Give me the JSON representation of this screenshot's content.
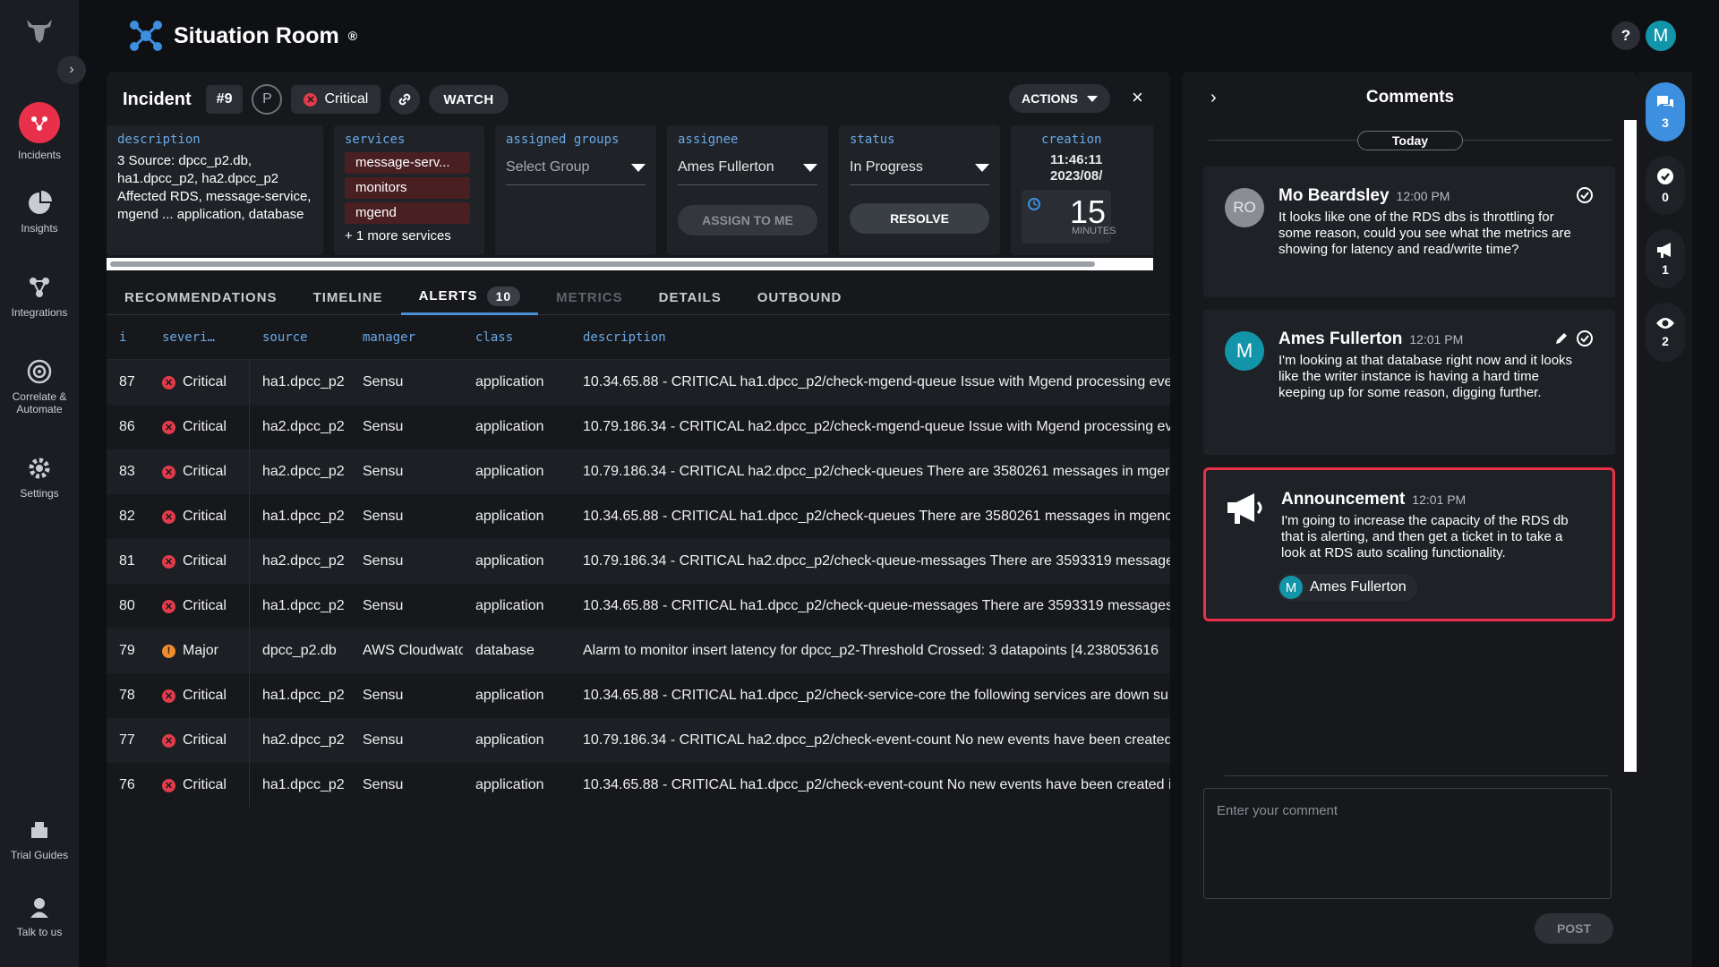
{
  "app": {
    "title": "Situation Room",
    "trademark": "®",
    "help": "?",
    "user_initial": "M"
  },
  "nav": {
    "items": [
      {
        "label": "Incidents",
        "icon": "incidents-icon"
      },
      {
        "label": "Insights",
        "icon": "pie-chart-icon"
      },
      {
        "label": "Integrations",
        "icon": "integrations-icon"
      },
      {
        "label": "Correlate & Automate",
        "icon": "target-icon"
      },
      {
        "label": "Settings",
        "icon": "gear-icon"
      },
      {
        "label": "Trial Guides",
        "icon": "book-icon"
      },
      {
        "label": "Talk to us",
        "icon": "support-icon"
      }
    ]
  },
  "incident": {
    "label": "Incident",
    "number": "#9",
    "priority": "P",
    "severity": "Critical",
    "watch": "WATCH",
    "actions": "ACTIONS",
    "close": "×",
    "description": {
      "label": "description",
      "text": "3 Source: dpcc_p2.db, ha1.dpcc_p2, ha2.dpcc_p2 Affected RDS, message-service, mgend ... application, database"
    },
    "services": {
      "label": "services",
      "items": [
        "message-serv...",
        "monitors",
        "mgend"
      ],
      "more": "+ 1 more services"
    },
    "groups": {
      "label": "assigned groups",
      "placeholder": "Select Group"
    },
    "assignee": {
      "label": "assignee",
      "value": "Ames Fullerton",
      "assign_me": "ASSIGN TO ME"
    },
    "status": {
      "label": "status",
      "value": "In Progress",
      "resolve": "RESOLVE"
    },
    "creation": {
      "label": "creation",
      "time": "11:46:11",
      "date": "2023/08/",
      "timer_value": "15",
      "timer_unit": "MINUTES"
    }
  },
  "tabs": [
    {
      "label": "RECOMMENDATIONS"
    },
    {
      "label": "TIMELINE"
    },
    {
      "label": "ALERTS",
      "badge": "10"
    },
    {
      "label": "METRICS"
    },
    {
      "label": "DETAILS"
    },
    {
      "label": "OUTBOUND"
    }
  ],
  "alerts": {
    "columns": [
      "i",
      "severi…",
      "source",
      "manager",
      "class",
      "description"
    ],
    "rows": [
      {
        "id": "87",
        "severity": "Critical",
        "source": "ha1.dpcc_p2",
        "manager": "Sensu",
        "class": "application",
        "description": "10.34.65.88 - CRITICAL ha1.dpcc_p2/check-mgend-queue Issue with Mgend processing eve"
      },
      {
        "id": "86",
        "severity": "Critical",
        "source": "ha2.dpcc_p2",
        "manager": "Sensu",
        "class": "application",
        "description": "10.79.186.34 - CRITICAL ha2.dpcc_p2/check-mgend-queue Issue with Mgend processing ev"
      },
      {
        "id": "83",
        "severity": "Critical",
        "source": "ha2.dpcc_p2",
        "manager": "Sensu",
        "class": "application",
        "description": "10.79.186.34 - CRITICAL ha2.dpcc_p2/check-queues There are 3580261 messages in mger"
      },
      {
        "id": "82",
        "severity": "Critical",
        "source": "ha1.dpcc_p2",
        "manager": "Sensu",
        "class": "application",
        "description": "10.34.65.88 - CRITICAL ha1.dpcc_p2/check-queues There are 3580261 messages in mgenc"
      },
      {
        "id": "81",
        "severity": "Critical",
        "source": "ha2.dpcc_p2",
        "manager": "Sensu",
        "class": "application",
        "description": "10.79.186.34 - CRITICAL ha2.dpcc_p2/check-queue-messages There are 3593319 message"
      },
      {
        "id": "80",
        "severity": "Critical",
        "source": "ha1.dpcc_p2",
        "manager": "Sensu",
        "class": "application",
        "description": "10.34.65.88 - CRITICAL ha1.dpcc_p2/check-queue-messages There are 3593319 messages"
      },
      {
        "id": "79",
        "severity": "Major",
        "source": "dpcc_p2.db",
        "manager": "AWS Cloudwatc",
        "class": "database",
        "description": "Alarm to monitor insert latency for dpcc_p2-Threshold Crossed: 3 datapoints [4.238053616"
      },
      {
        "id": "78",
        "severity": "Critical",
        "source": "ha1.dpcc_p2",
        "manager": "Sensu",
        "class": "application",
        "description": "10.34.65.88 - CRITICAL ha1.dpcc_p2/check-service-core the following services are down su"
      },
      {
        "id": "77",
        "severity": "Critical",
        "source": "ha2.dpcc_p2",
        "manager": "Sensu",
        "class": "application",
        "description": "10.79.186.34 - CRITICAL ha2.dpcc_p2/check-event-count No new events have been created"
      },
      {
        "id": "76",
        "severity": "Critical",
        "source": "ha1.dpcc_p2",
        "manager": "Sensu",
        "class": "application",
        "description": "10.34.65.88 - CRITICAL ha1.dpcc_p2/check-event-count No new events have been created i"
      }
    ]
  },
  "comments": {
    "title": "Comments",
    "day": "Today",
    "items": [
      {
        "initials": "RO",
        "author": "Mo Beardsley",
        "time": "12:00 PM",
        "text": "It looks like one of the RDS dbs is throttling for some reason, could you see what the metrics are showing for latency and read/write time?"
      },
      {
        "initials": "M",
        "author": "Ames Fullerton",
        "time": "12:01 PM",
        "text": "I'm looking at that database right now and it looks like the writer instance is having a hard time keeping up for some reason, digging further."
      },
      {
        "author": "Announcement",
        "time": "12:01 PM",
        "text": "I'm going to increase the capacity of the RDS db that is alerting, and then get a ticket in to take a look at RDS auto scaling functionality.",
        "by_initial": "M",
        "by": "Ames Fullerton"
      }
    ],
    "placeholder": "Enter your comment",
    "post": "POST"
  },
  "rail": {
    "comments": "3",
    "approvals": "0",
    "announcements": "1",
    "watchers": "2"
  },
  "colors": {
    "critical": "#e23b4a",
    "major": "#f28c28",
    "accent": "#3d8fe0",
    "brand": "#e8304a"
  }
}
